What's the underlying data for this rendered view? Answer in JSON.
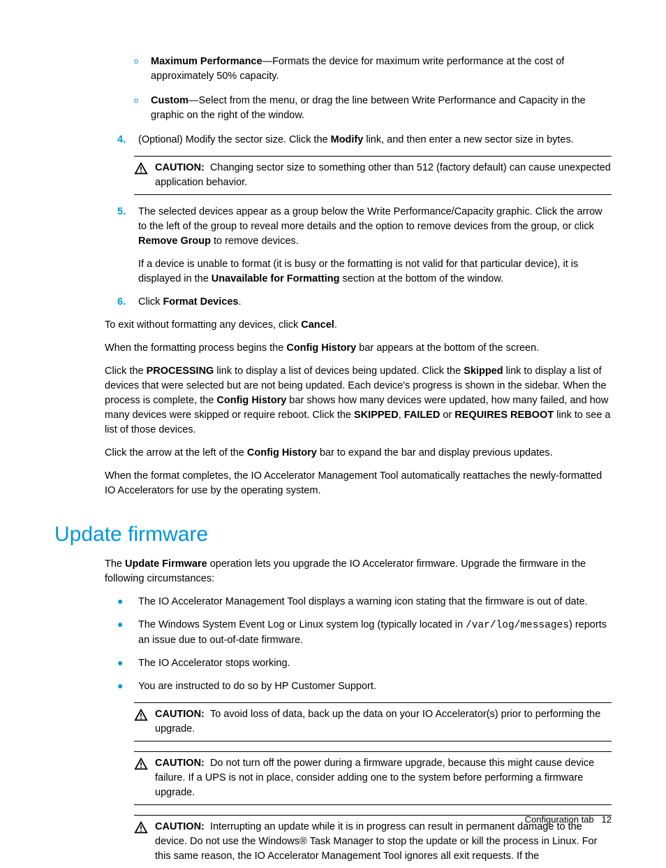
{
  "bullets": {
    "maxPerf": {
      "label": "Maximum Performance",
      "text": "—Formats the device for maximum write performance at the cost of approximately 50% capacity."
    },
    "custom": {
      "label": "Custom",
      "text": "—Select from the menu, or drag the line between Write Performance and Capacity in the graphic on the right of the window."
    }
  },
  "steps": {
    "s4": {
      "num": "4.",
      "pre": "(Optional) Modify the sector size. Click the ",
      "b1": "Modify",
      "post": " link, and then enter a new sector size in bytes."
    },
    "s5": {
      "num": "5.",
      "p1a": "The selected devices appear as a group below the Write Performance/Capacity graphic. Click the arrow to the left of the group to reveal more details and the option to remove devices from the group, or click ",
      "p1b": "Remove Group",
      "p1c": " to remove devices.",
      "p2a": "If a device is unable to format (it is busy or the formatting is not valid for that particular device), it is displayed in the ",
      "p2b": "Unavailable for Formatting",
      "p2c": " section at the bottom of the window."
    },
    "s6": {
      "num": "6.",
      "pre": "Click ",
      "b1": "Format Devices",
      "post": "."
    }
  },
  "caution1": {
    "label": "CAUTION:",
    "text": "Changing sector size to something other than 512 (factory default) can cause unexpected application behavior."
  },
  "paras": {
    "exit": {
      "a": "To exit without formatting any devices, click ",
      "b": "Cancel",
      "c": "."
    },
    "begin": {
      "a": "When the formatting process begins the ",
      "b": "Config History",
      "c": " bar appears at the bottom of the screen."
    },
    "proc": {
      "a": "Click the ",
      "b1": "PROCESSING",
      "c": " link to display a list of devices being updated. Click the ",
      "b2": "Skipped",
      "d": " link to display a list of devices that were selected but are not being updated. Each device's progress is shown in the sidebar. When the process is complete, the ",
      "b3": "Config History",
      "e": " bar shows how many devices were updated, how many failed, and how many devices were skipped or require reboot. Click the ",
      "b4": "SKIPPED",
      "f": ", ",
      "b5": "FAILED",
      "g": " or ",
      "b6": "REQUIRES REBOOT",
      "h": " link to see a list of those devices."
    },
    "arrow": {
      "a": "Click the arrow at the left of the ",
      "b": "Config History",
      "c": " bar to expand the bar and display previous updates."
    },
    "complete": "When the format completes, the IO Accelerator Management Tool automatically reattaches the newly-formatted IO Accelerators for use by the operating system."
  },
  "section2": {
    "heading": "Update firmware",
    "intro": {
      "a": "The ",
      "b": "Update Firmware",
      "c": " operation lets you upgrade the IO Accelerator firmware. Upgrade the firmware in the following circumstances:"
    },
    "items": {
      "i1": "The IO Accelerator Management Tool displays a warning icon stating that the firmware is out of date.",
      "i2": {
        "a": "The Windows System Event Log or Linux system log (typically located in ",
        "code": "/var/log/messages",
        "b": ") reports an issue due to out-of-date firmware."
      },
      "i3": "The IO Accelerator stops working.",
      "i4": "You are instructed to do so by HP Customer Support."
    },
    "c1": {
      "label": "CAUTION:",
      "text": "To avoid loss of data, back up the data on your IO Accelerator(s) prior to performing the upgrade."
    },
    "c2": {
      "label": "CAUTION:",
      "text": "Do not turn off the power during a firmware upgrade, because this might cause device failure. If a UPS is not in place, consider adding one to the system before performing a firmware upgrade."
    },
    "c3": {
      "label": "CAUTION:",
      "text": "Interrupting an update while it is in progress can result in permanent damage to the device. Do not use the Windows® Task Manager to stop the update or kill the process in Linux. For this same reason, the IO Accelerator Management Tool ignores all exit requests. If the"
    }
  },
  "footer": {
    "label": "Configuration tab",
    "page": "12"
  }
}
